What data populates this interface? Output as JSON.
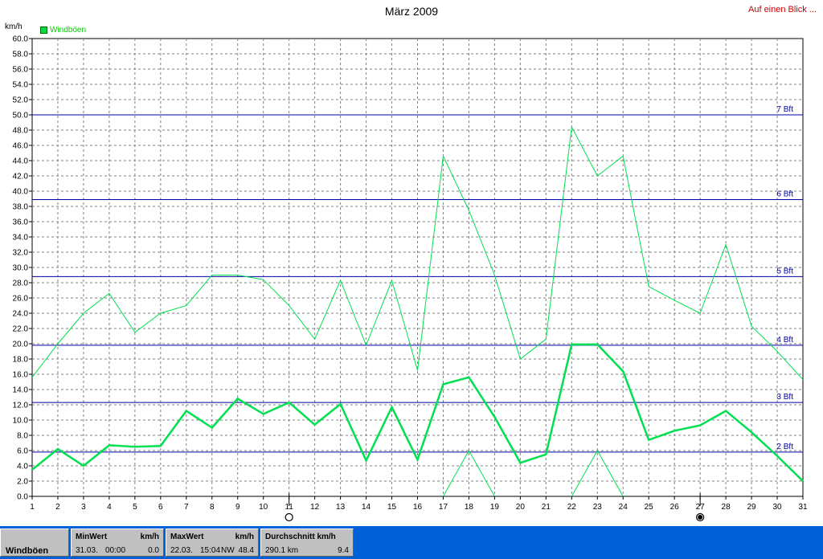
{
  "header": {
    "title": "März 2009",
    "link_label": "Auf einen Blick ..."
  },
  "chart_data": {
    "type": "line",
    "ylabel": "km/h",
    "ylim": [
      0,
      60
    ],
    "ytick_step": 2,
    "categories": [
      "1",
      "2",
      "3",
      "4",
      "5",
      "6",
      "7",
      "8",
      "9",
      "10",
      "11",
      "12",
      "13",
      "14",
      "15",
      "16",
      "17",
      "18",
      "19",
      "20",
      "21",
      "22",
      "23",
      "24",
      "25",
      "26",
      "27",
      "28",
      "29",
      "30",
      "31"
    ],
    "legend": [
      "Windböen"
    ],
    "series": [
      {
        "name": "Windböen",
        "color": "#00e050",
        "width": 1,
        "values": [
          15.6,
          20.0,
          24.0,
          26.6,
          21.5,
          24.0,
          25.0,
          29.0,
          29.0,
          28.4,
          25.0,
          20.6,
          28.3,
          19.8,
          28.3,
          16.5,
          44.6,
          37.5,
          29.0,
          18.0,
          20.6,
          48.4,
          42.0,
          44.6,
          27.5,
          25.7,
          24.0,
          33.0,
          22.3,
          19.0,
          15.3
        ]
      },
      {
        "name": "",
        "color": "#00e050",
        "width": 2.5,
        "values": [
          3.5,
          6.2,
          4.0,
          6.7,
          6.5,
          6.6,
          11.2,
          9.0,
          12.8,
          10.8,
          12.3,
          9.4,
          12.1,
          4.7,
          11.7,
          4.8,
          14.7,
          15.6,
          10.4,
          4.4,
          5.5,
          19.9,
          19.9,
          16.4,
          7.4,
          8.6,
          9.3,
          11.2,
          8.4,
          5.3,
          2.0
        ]
      },
      {
        "name": "",
        "color": "#00e050",
        "width": 1,
        "values": [
          null,
          null,
          null,
          null,
          null,
          null,
          null,
          null,
          null,
          null,
          null,
          null,
          null,
          null,
          null,
          null,
          0,
          6.0,
          0,
          null,
          null,
          0,
          6.0,
          0,
          null,
          null,
          null,
          null,
          null,
          null,
          null
        ]
      }
    ],
    "reference_lines": [
      {
        "label": "2 Bft",
        "value": 5.8
      },
      {
        "label": "3 Bft",
        "value": 12.3
      },
      {
        "label": "4 Bft",
        "value": 19.8
      },
      {
        "label": "5 Bft",
        "value": 28.8
      },
      {
        "label": "6 Bft",
        "value": 38.9
      },
      {
        "label": "7 Bft",
        "value": 50.0
      }
    ],
    "moon_phases": [
      {
        "day": 11,
        "phase": "full"
      },
      {
        "day": 27,
        "phase": "new"
      }
    ],
    "grid": true
  },
  "footer": {
    "series_label": "Windböen",
    "min": {
      "head_label": "MinWert",
      "head_unit": "km/h",
      "date": "31.03.",
      "time": "00:00",
      "value": "0.0"
    },
    "max": {
      "head_label": "MaxWert",
      "head_unit": "km/h",
      "date": "22.03.",
      "time": "15:04",
      "dir": "NW",
      "value": "48.4"
    },
    "avg": {
      "head_label": "Durchschnitt km/h",
      "distance": "290.1 km",
      "value": "9.4"
    }
  },
  "colors": {
    "reference_line": "#0000aa",
    "series": "#00e050",
    "footer_bg": "#0060d8",
    "link": "#cc0000"
  }
}
